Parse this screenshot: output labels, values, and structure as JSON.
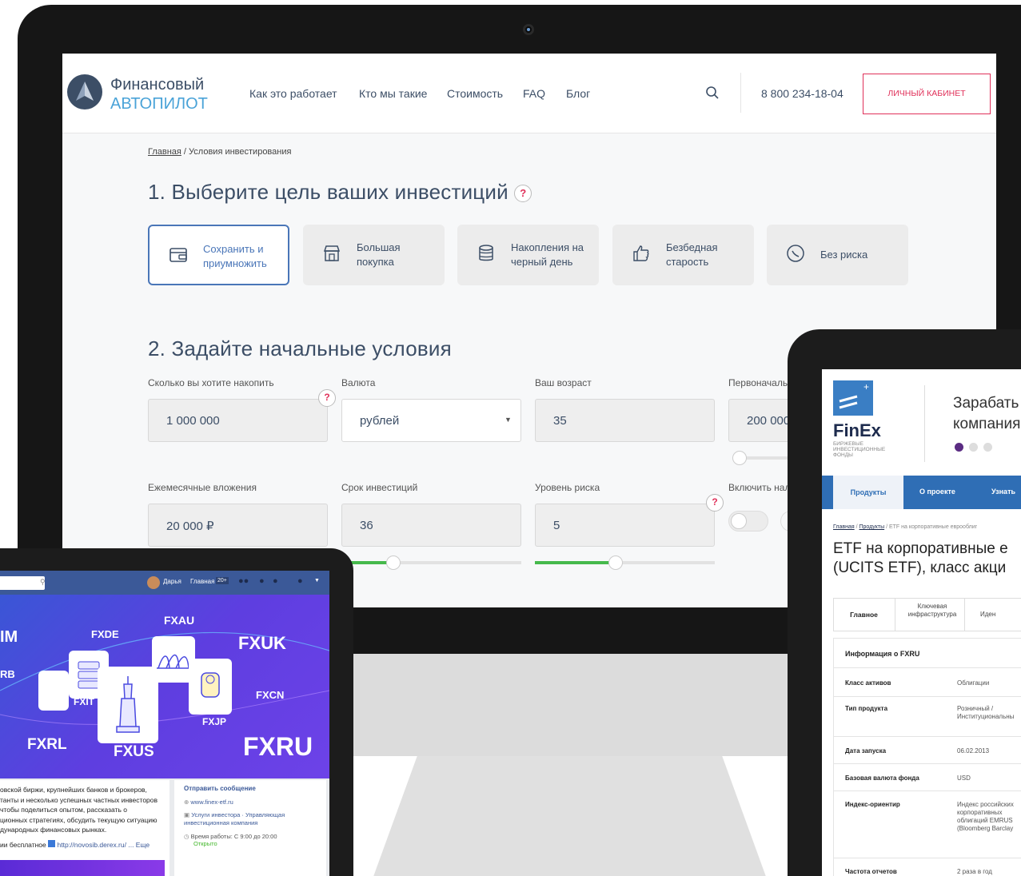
{
  "site": {
    "logo_line1": "Финансовый",
    "logo_line2": "АВТОПИЛОТ",
    "nav": [
      "Как это работает",
      "Кто мы такие",
      "Стоимость",
      "FAQ",
      "Блог"
    ],
    "phone": "8 800 234-18-04",
    "cabinet_button": "ЛИЧНЫЙ КАБИНЕТ",
    "breadcrumb_home": "Главная",
    "breadcrumb_current": " / Условия инвестирования",
    "section1_title": "1. Выберите цель ваших инвестиций",
    "help_mark": "?",
    "goals": [
      {
        "line1": "Сохранить и",
        "line2": "приумножить",
        "icon": "wallet-icon"
      },
      {
        "line1": "Большая",
        "line2": "покупка",
        "icon": "shop-icon"
      },
      {
        "line1": "Накопления на",
        "line2": "черный день",
        "icon": "database-icon"
      },
      {
        "line1": "Безбедная",
        "line2": "старость",
        "icon": "thumbs-up-icon"
      },
      {
        "line1": "Без риска",
        "line2": "",
        "icon": "shield-icon"
      }
    ],
    "section2_title": "2. Задайте начальные условия",
    "fields": {
      "amount_label": "Сколько вы хотите накопить",
      "amount_value": "1 000 000",
      "currency_label": "Валюта",
      "currency_value": "рублей",
      "age_label": "Ваш возраст",
      "age_value": "35",
      "initial_label": "Первоначаль",
      "initial_value": "200 000",
      "monthly_label": "Ежемесячные вложения",
      "monthly_value": "20 000 ₽",
      "term_label": "Срок инвестиций",
      "term_value": "36",
      "risk_label": "Уровень риска",
      "risk_value": "5",
      "include_label": "Включить нал"
    },
    "colors": {
      "brand": "#3c4e66",
      "accent": "#e0315a",
      "slider": "#46b94c",
      "selected": "#4a76b8"
    }
  },
  "laptop": {
    "user_name": "Дарья",
    "home_link": "Главная",
    "home_count": "20+",
    "banner_tickers": [
      "FXAU",
      "FXDE",
      "FXUK",
      "FXCN",
      "FXIT",
      "FXJP",
      "FXRL",
      "FXUS",
      "FXRU",
      "IM",
      "RB"
    ],
    "about_lines": [
      "овской биржи, крупнейших банков и брокеров,",
      "танты и несколько успешных частных инвесторов",
      "чтобы поделиться опытом, рассказать о",
      "ционных стратегиях, обсудить текущую ситуацию",
      "дународных финансовых рынках.",
      "ии бесплатное"
    ],
    "about_link": "http://novosib.derex.ru/ ... Еще",
    "send_message": "Отправить сообщение",
    "website": "www.finex-etf.ru",
    "services": "Услуги инвестора · Управляющая инвестиционная компания",
    "hours": "Время работы: С 9:00 до 20:00",
    "open": "Открыто"
  },
  "tablet": {
    "logo": "FinEx",
    "logo_sub": "БИРЖЕВЫЕ ИНВЕСТИЦИОННЫЕ ФОНДЫ",
    "slogan_1": "Зарабать",
    "slogan_2": "компания",
    "menu": [
      "Продукты",
      "О проекте",
      "Узнать"
    ],
    "crumb_home": "Главная",
    "crumb_products": "Продукты",
    "crumb_rest": " / ETF на корпоративные еврооблиг",
    "title_1": "ETF на корпоративные е",
    "title_2": "(UCITS ETF), класс акци",
    "tabs": [
      "Главное",
      "Ключевая инфраструктура",
      "Иден"
    ],
    "info_title": "Информация о FXRU",
    "rows": [
      {
        "label": "Класс активов",
        "value": "Облигации"
      },
      {
        "label": "Тип продукта",
        "value": "Розничный / Институциональны"
      },
      {
        "label": "Дата запуска",
        "value": "06.02.2013"
      },
      {
        "label": "Базовая валюта фонда",
        "value": "USD"
      },
      {
        "label": "Индекс-ориентир",
        "value": "Индекс российских корпоративных облигаций EMRUS (Bloomberg Barclay"
      },
      {
        "label": "Частота отчетов",
        "value": "2 раза в год"
      }
    ]
  }
}
